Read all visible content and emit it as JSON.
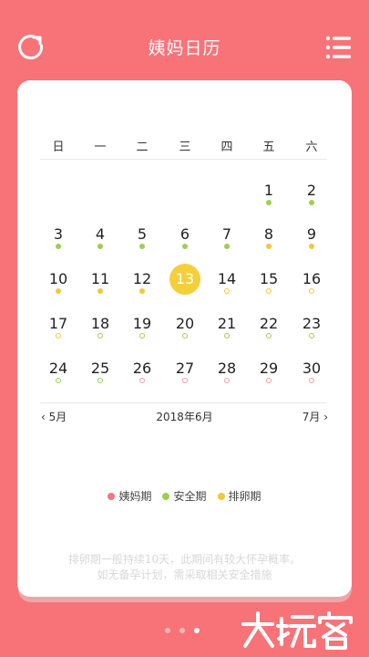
{
  "header": {
    "title": "姨妈日历"
  },
  "weekdays": [
    "日",
    "一",
    "二",
    "三",
    "四",
    "五",
    "六"
  ],
  "days": [
    "1",
    "2",
    "3",
    "4",
    "5",
    "6",
    "7",
    "8",
    "9",
    "10",
    "11",
    "12",
    "13",
    "14",
    "15",
    "16",
    "17",
    "18",
    "19",
    "20",
    "21",
    "22",
    "23",
    "24",
    "25",
    "26",
    "27",
    "28",
    "29",
    "30"
  ],
  "today": "13",
  "nav": {
    "prev": "5月",
    "current": "2018年6月",
    "next": "7月"
  },
  "legend": [
    {
      "label": "姨妈期",
      "color": "#f0787e"
    },
    {
      "label": "安全期",
      "color": "#9bd04f"
    },
    {
      "label": "排卵期",
      "color": "#f4c63a"
    }
  ],
  "colors": {
    "background": "#f87378",
    "safe": "#9bd04f",
    "ovulation": "#f4c63a",
    "period": "#f79aa0"
  },
  "tip": {
    "line1": "排卵期一般持续10天，此期间有较大怀孕概率。",
    "line2": "如无备孕计划，需采取相关安全措施"
  }
}
